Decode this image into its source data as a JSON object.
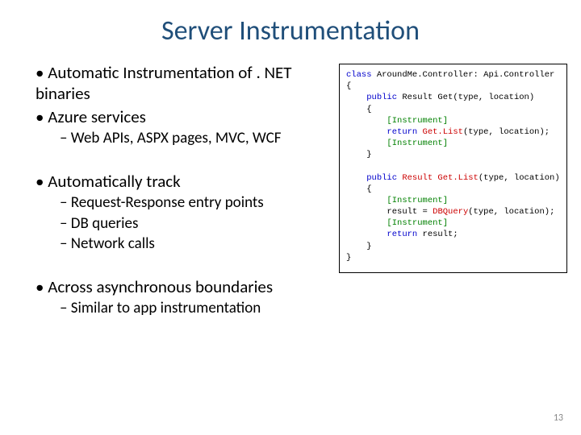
{
  "title": "Server Instrumentation",
  "b1": "Automatic Instrumentation of . NET binaries",
  "b2": "Azure services",
  "b2a": "Web APIs, ASPX pages, MVC, WCF",
  "b3": "Automatically track",
  "b3a": "Request-Response entry points",
  "b3b": "DB queries",
  "b3c": "Network calls",
  "b4": "Across asynchronous boundaries",
  "b4a": "Similar to app instrumentation",
  "code": {
    "l1a": "class ",
    "l1b": "AroundMe.Controller",
    "l1c": ": Api.Controller",
    "l2": "{",
    "l3a": "public ",
    "l3b": "Result Get(type, location)",
    "l4": "{",
    "l5": "[Instrument]",
    "l6a": "return ",
    "l6b": "Get.List",
    "l6c": "(type, location);",
    "l7": "[Instrument]",
    "l8": "}",
    "l9a": "public ",
    "l9b": "Result Get.List",
    "l9c": "(type, location)",
    "l10": "{",
    "l11": "[Instrument]",
    "l12a": "result = ",
    "l12b": "DBQuery",
    "l12c": "(type, location);",
    "l13": "[Instrument]",
    "l14a": "return ",
    "l14b": "result;",
    "l15": "}",
    "l16": "}"
  },
  "pagenum": "13"
}
